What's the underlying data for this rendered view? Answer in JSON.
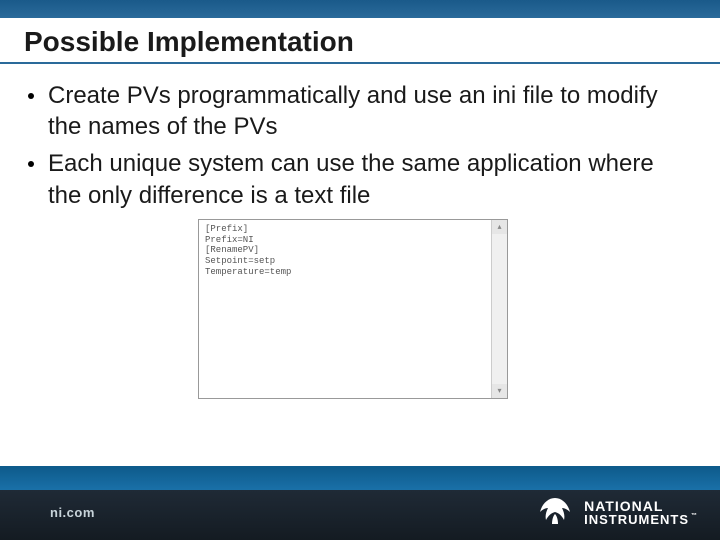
{
  "title": "Possible Implementation",
  "bullets": [
    "Create PVs programmatically and use an ini file to modify the names of the PVs",
    "Each unique system can use the same application where the only difference is a text file"
  ],
  "ini_content": "[Prefix]\nPrefix=NI\n[RenamePV]\nSetpoint=setp\nTemperature=temp",
  "footer": {
    "url": "ni.com"
  },
  "logo": {
    "line1": "NATIONAL",
    "line2": "INSTRUMENTS",
    "tm": "™"
  }
}
